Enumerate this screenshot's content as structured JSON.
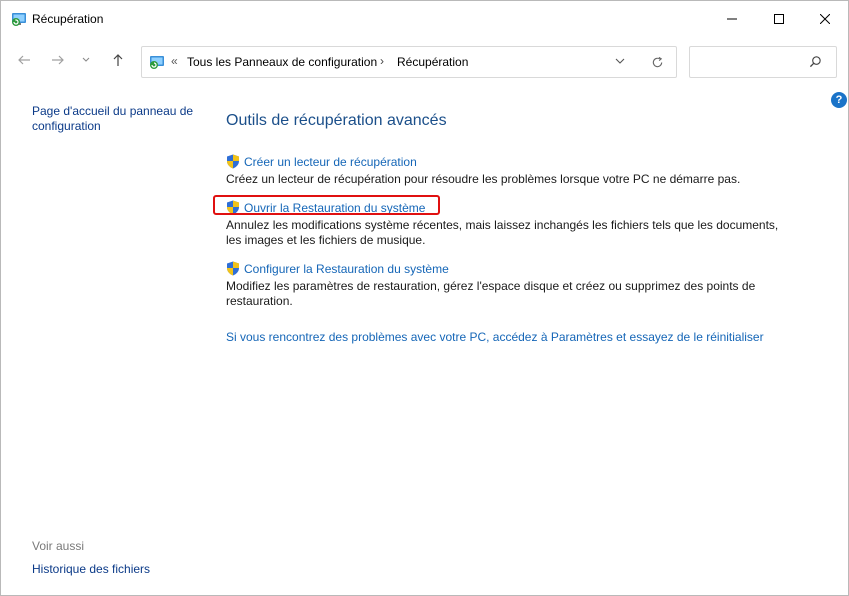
{
  "window": {
    "title": "Récupération"
  },
  "address_bar": {
    "overflow_chevron": "«",
    "breadcrumbs": [
      "Tous les Panneaux de configuration",
      "Récupération"
    ],
    "separator": "›"
  },
  "search": {
    "placeholder": ""
  },
  "help": {
    "label": "?"
  },
  "left_pane": {
    "home_link": "Page d'accueil du panneau de configuration",
    "see_also_heading": "Voir aussi",
    "see_also_links": [
      "Historique des fichiers"
    ]
  },
  "main": {
    "heading": "Outils de récupération avancés",
    "tasks": [
      {
        "link": "Créer un lecteur de récupération",
        "description": "Créez un lecteur de récupération pour résoudre les problèmes lorsque votre PC ne démarre pas."
      },
      {
        "link": "Ouvrir la Restauration du système",
        "description": "Annulez les modifications système récentes, mais laissez inchangés les fichiers tels que les documents, les images et les fichiers de musique.",
        "highlighted": true
      },
      {
        "link": "Configurer la Restauration du système",
        "description": "Modifiez les paramètres de restauration, gérez l'espace disque et créez ou supprimez des points de restauration."
      }
    ],
    "reset_link": "Si vous rencontrez des problèmes avec votre PC, accédez à Paramètres et essayez de le réinitialiser"
  },
  "colors": {
    "link": "#1566b7",
    "heading": "#1b4f8a",
    "highlight_border": "#e01010",
    "shield_blue": "#2f6fd6",
    "shield_yellow": "#f2c318"
  }
}
